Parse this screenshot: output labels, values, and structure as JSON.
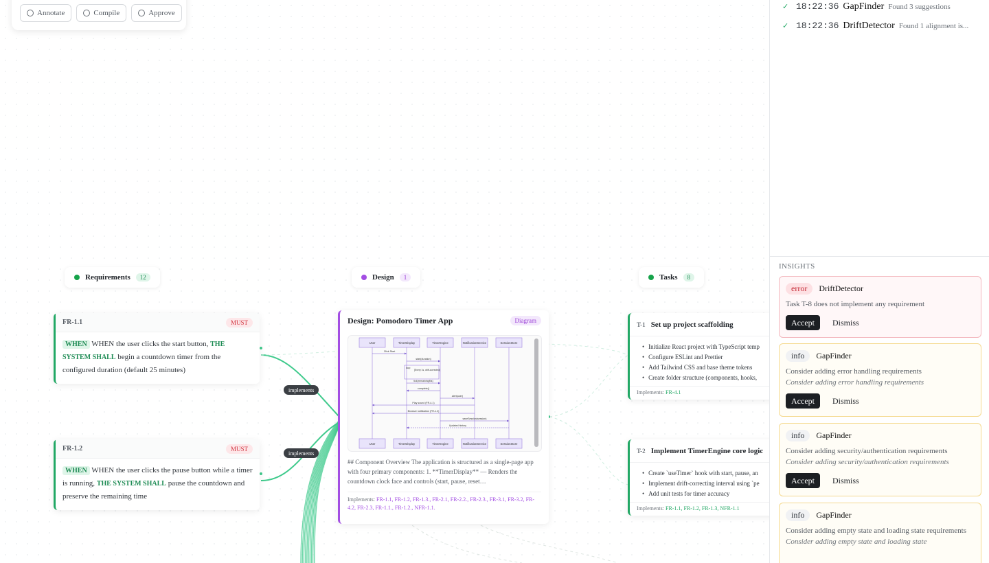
{
  "toolbar": {
    "annotate": "Annotate",
    "compile": "Compile",
    "approve": "Approve"
  },
  "columns": {
    "requirements": {
      "label": "Requirements",
      "count": "12",
      "color": "#16a34a"
    },
    "design": {
      "label": "Design",
      "count": "1",
      "color": "#a34ee3"
    },
    "tasks": {
      "label": "Tasks",
      "count": "8",
      "color": "#16a34a"
    }
  },
  "requirements": [
    {
      "id": "FR-1.1",
      "priority": "MUST",
      "when": "WHEN",
      "pre": "WHEN the user clicks the start button,",
      "shall": "THE SYSTEM SHALL",
      "post": "begin a countdown timer from the configured duration (default 25 minutes)"
    },
    {
      "id": "FR-1.2",
      "priority": "MUST",
      "when": "WHEN",
      "pre": "WHEN the user clicks the pause button while a timer is running,",
      "shall": "THE SYSTEM SHALL",
      "post": "pause the countdown and preserve the remaining time"
    }
  ],
  "edge_labels": [
    "implements",
    "implements"
  ],
  "design": {
    "title": "Design: Pomodoro Timer App",
    "badge": "Diagram",
    "diagram": {
      "participants": [
        "User",
        "TimerDisplay",
        "TimerEngine",
        "NotificationService",
        "SessionStore"
      ],
      "messages": [
        "Click Start",
        "start(duration)",
        "loop",
        "[Every 1s, drift-corrected]",
        "tick(remainingMs)",
        "complete()",
        "alert(user)",
        "Play sound (FR-4.1)",
        "Browser notification (FR-1.2)",
        "saveSession(session)",
        "Updated history"
      ]
    },
    "text": "## Component Overview The application is structured as a single-page app with four primary components: 1. **TimerDisplay** — Renders the countdown clock face and controls (start, pause, reset…",
    "implements_label": "Implements:",
    "implements": "FR-1.1, FR-1.2, FR-1.3., FR-2.1, FR-2.2., FR-2.3., FR-3.1, FR-3.2, FR-4.2, FR-2.3, FR-1.1., FR-1.2., NFR-1.1."
  },
  "tasks": [
    {
      "id": "T-1",
      "title": "Set up project scaffolding",
      "items": [
        "Initialize React project with TypeScript temp",
        "Configure ESLint and Prettier",
        "Add Tailwind CSS and base theme tokens",
        "Create folder structure (components, hooks,"
      ],
      "implements_label": "Implements:",
      "implements": "FR-4.1"
    },
    {
      "id": "T-2",
      "title": "Implement TimerEngine core logic",
      "items": [
        "Create `useTimer` hook with start, pause, an",
        "Implement drift-correcting interval using `pe",
        "Add unit tests for timer accuracy"
      ],
      "implements_label": "Implements:",
      "implements": "FR-1.1, FR-1.2, FR-1.3, NFR-1.1"
    }
  ],
  "activity": [
    {
      "time": "18:22:36",
      "agent": "GapFinder",
      "message": "Found 3 suggestions"
    },
    {
      "time": "18:22:36",
      "agent": "DriftDetector",
      "message": "Found 1 alignment is..."
    }
  ],
  "insights_title": "INSIGHTS",
  "insights": [
    {
      "severity": "error",
      "agent": "DriftDetector",
      "text": "Task T-8 does not implement any requirement",
      "sub": "",
      "accept": "Accept",
      "dismiss": "Dismiss"
    },
    {
      "severity": "info",
      "agent": "GapFinder",
      "text": "Consider adding error handling requirements",
      "sub": "Consider adding error handling requirements",
      "accept": "Accept",
      "dismiss": "Dismiss"
    },
    {
      "severity": "info",
      "agent": "GapFinder",
      "text": "Consider adding security/authentication requirements",
      "sub": "Consider adding security/authentication requirements",
      "accept": "Accept",
      "dismiss": "Dismiss"
    },
    {
      "severity": "info",
      "agent": "GapFinder",
      "text": "Consider adding empty state and loading state requirements",
      "sub": "Consider adding empty state and loading state",
      "accept": "",
      "dismiss": ""
    }
  ],
  "colors": {
    "requirement": "#22a865",
    "design": "#a34ee3",
    "edge": "#3fca8c",
    "error": "#d1343f",
    "warning_border": "#f5d98e"
  }
}
